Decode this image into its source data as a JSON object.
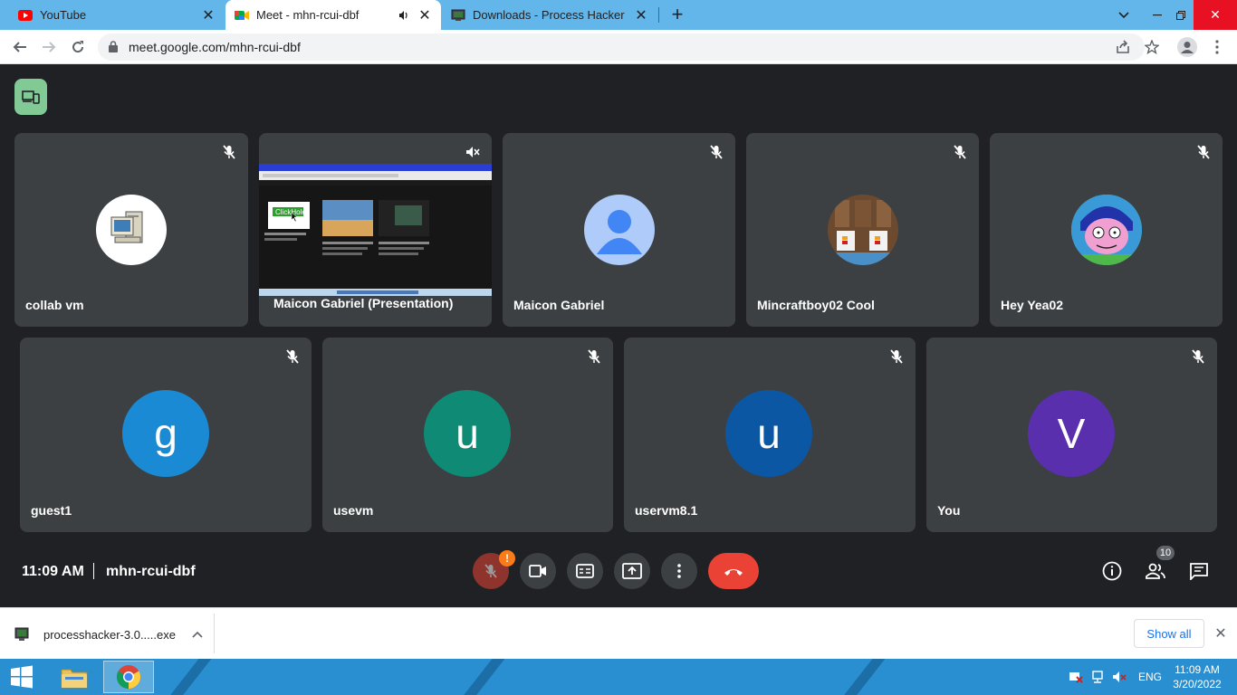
{
  "browser": {
    "tabs": [
      {
        "title": "YouTube",
        "favicon": "youtube-icon",
        "active": false
      },
      {
        "title": "Meet - mhn-rcui-dbf",
        "favicon": "meet-icon",
        "active": true,
        "audio": true
      },
      {
        "title": "Downloads - Process Hacker",
        "favicon": "process-hacker-icon",
        "active": false
      }
    ],
    "url": "meet.google.com/mhn-rcui-dbf"
  },
  "meet": {
    "participants": [
      {
        "name": "collab vm",
        "avatar_type": "image",
        "avatar_desc": "computer-icon",
        "muted": true
      },
      {
        "name": "Maicon Gabriel (Presentation)",
        "avatar_type": "presentation",
        "muted": true
      },
      {
        "name": "Maicon Gabriel",
        "avatar_type": "default-person",
        "muted": true
      },
      {
        "name": "Mincraftboy02 Cool",
        "avatar_type": "image",
        "avatar_desc": "minecraft-chickens",
        "muted": true
      },
      {
        "name": "Hey Yea02",
        "avatar_type": "image",
        "avatar_desc": "cartoon-character",
        "muted": true
      },
      {
        "name": "guest1",
        "avatar_type": "letter",
        "letter": "g",
        "color": "#1a8ad4",
        "muted": true
      },
      {
        "name": "usevm",
        "avatar_type": "letter",
        "letter": "u",
        "color": "#0f8a75",
        "muted": true
      },
      {
        "name": "uservm8.1",
        "avatar_type": "letter",
        "letter": "u",
        "color": "#0b57a3",
        "muted": true
      },
      {
        "name": "You",
        "avatar_type": "letter",
        "letter": "V",
        "color": "#5a2fad",
        "muted": true
      }
    ],
    "time": "11:09 AM",
    "meeting_code": "mhn-rcui-dbf",
    "warning_badge": "!",
    "participant_count": "10",
    "presentation_logo_text": "ClickHole"
  },
  "downloads": {
    "item": "processhacker-3.0.....exe",
    "show_all": "Show all"
  },
  "taskbar": {
    "language": "ENG",
    "time": "11:09 AM",
    "date": "3/20/2022"
  },
  "colors": {
    "tabstrip": "#63b6ea",
    "meet_bg": "#202124",
    "tile_bg": "#3c4043",
    "end_call": "#ea4335",
    "taskbar": "#2a8fd0"
  }
}
